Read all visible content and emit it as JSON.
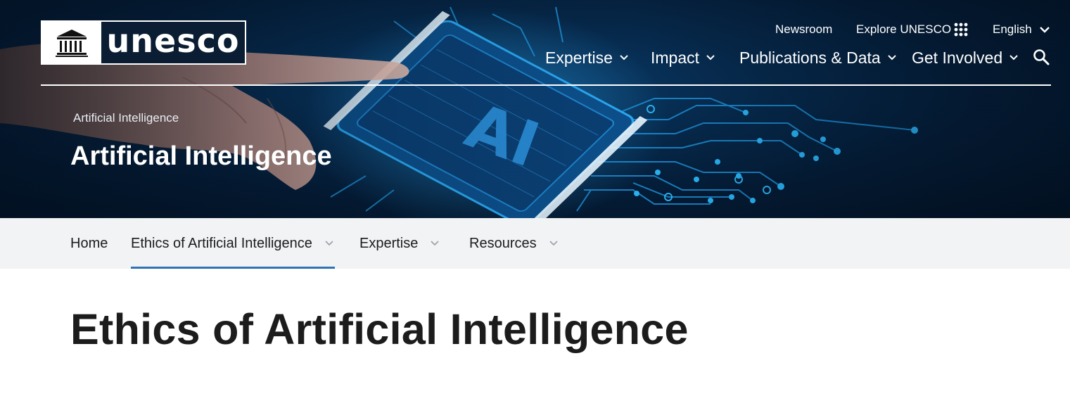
{
  "logo": {
    "wordmark": "unesco",
    "emblem_text": "UNESCO"
  },
  "utility": {
    "newsroom": "Newsroom",
    "explore": "Explore UNESCO",
    "language": "English",
    "grid_icon": "grid-icon",
    "chevron_icon": "chevron-down-icon"
  },
  "main_nav": {
    "items": [
      {
        "label": "Expertise"
      },
      {
        "label": "Impact"
      },
      {
        "label": "Publications & Data"
      },
      {
        "label": "Get Involved"
      }
    ],
    "search_icon": "search-icon"
  },
  "hero": {
    "breadcrumb": "Artificial Intelligence",
    "title": "Artificial Intelligence",
    "chip_text": "AI"
  },
  "sub_nav": {
    "items": [
      {
        "label": "Home",
        "active": false
      },
      {
        "label": "Ethics of Artificial Intelligence",
        "active": true
      },
      {
        "label": "Expertise",
        "active": false
      },
      {
        "label": "Resources",
        "active": false
      }
    ]
  },
  "main": {
    "title": "Ethics of Artificial Intelligence"
  },
  "colors": {
    "hero_dark": "#041a33",
    "circuit": "#1ea0e6",
    "subnav_bg": "#f1f3f5",
    "active_underline": "#2f73b6",
    "text": "#1c1c1c"
  }
}
